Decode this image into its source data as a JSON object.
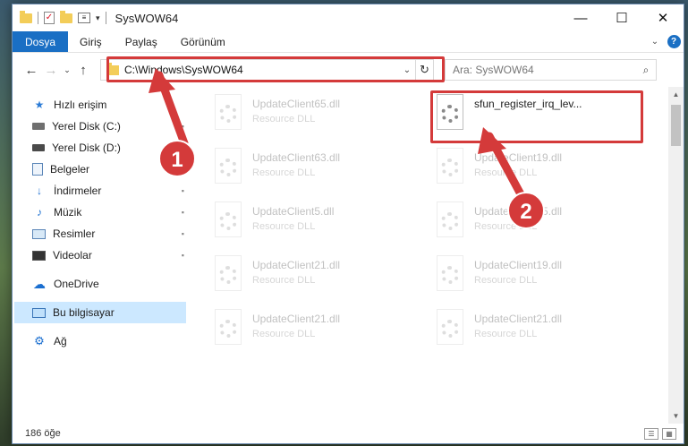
{
  "window": {
    "title": "SysWOW64",
    "minimize": "—",
    "maximize": "☐",
    "close": "✕"
  },
  "ribbon": {
    "tabs": [
      "Dosya",
      "Giriş",
      "Paylaş",
      "Görünüm"
    ],
    "expand": "⌄",
    "help": "?"
  },
  "nav": {
    "back": "←",
    "forward": "→",
    "recent": "⌄",
    "up": "↑"
  },
  "address": {
    "path": "C:\\Windows\\SysWOW64",
    "dropdown": "⌄",
    "refresh": "↻"
  },
  "search": {
    "placeholder": "Ara: SysWOW64",
    "icon": "⌕"
  },
  "sidebar": {
    "items": [
      {
        "label": "Hızlı erişim",
        "icon": "star-icon",
        "glyph": "★"
      },
      {
        "label": "Yerel Disk (C:)",
        "icon": "drive-icon",
        "pinned": true
      },
      {
        "label": "Yerel Disk (D:)",
        "icon": "drive-icon"
      },
      {
        "label": "Belgeler",
        "icon": "document-icon",
        "pinned": true
      },
      {
        "label": "İndirmeler",
        "icon": "download-icon",
        "glyph": "↓",
        "pinned": true
      },
      {
        "label": "Müzik",
        "icon": "music-icon",
        "glyph": "♪",
        "pinned": true
      },
      {
        "label": "Resimler",
        "icon": "pictures-icon",
        "pinned": true
      },
      {
        "label": "Videolar",
        "icon": "videos-icon",
        "pinned": true
      },
      {
        "label": "OneDrive",
        "icon": "cloud-icon",
        "glyph": "☁"
      },
      {
        "label": "Bu bilgisayar",
        "icon": "computer-icon",
        "selected": true
      },
      {
        "label": "Ağ",
        "icon": "network-icon",
        "glyph": "⚙"
      }
    ],
    "pin_glyph": "📌"
  },
  "files": [
    {
      "name": "UpdateClient65.dll",
      "type": "Resource DLL"
    },
    {
      "name": "sfun_register_irq_lev...",
      "type": ""
    },
    {
      "name": "UpdateClient63.dll",
      "type": "Resource DLL"
    },
    {
      "name": "UpdateClient19.dll",
      "type": "Resource DLL"
    },
    {
      "name": "UpdateClient5.dll",
      "type": "Resource DLL"
    },
    {
      "name": "UpdateClient65.dll",
      "type": "Resource DLL"
    },
    {
      "name": "UpdateClient21.dll",
      "type": "Resource DLL"
    },
    {
      "name": "UpdateClient19.dll",
      "type": "Resource DLL"
    },
    {
      "name": "UpdateClient21.dll",
      "type": "Resource DLL"
    },
    {
      "name": "UpdateClient21.dll",
      "type": "Resource DLL"
    }
  ],
  "status": {
    "count": "186 öğe",
    "details_view": "☰",
    "icons_view": "▦"
  },
  "annotations": [
    "1",
    "2"
  ],
  "colors": {
    "accent": "#1a6fc4",
    "highlight": "#d43a3a",
    "selected": "#cce8ff"
  }
}
